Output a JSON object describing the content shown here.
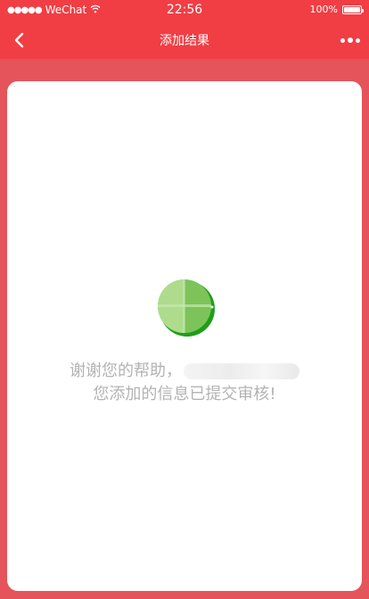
{
  "status_bar": {
    "signal_dots": "●●●●●",
    "carrier": "WeChat",
    "wifi_icon": "wifi-icon",
    "time": "22:56",
    "battery": "100%"
  },
  "nav": {
    "back_icon": "chevron-left-icon",
    "title": "添加结果",
    "more_icon": "more-dots-icon"
  },
  "result": {
    "icon": "success-check-icon",
    "line1": "谢谢您的帮助，",
    "line2": "您添加的信息已提交审核!"
  },
  "colors": {
    "header": "#f03e44",
    "background": "#e4545a",
    "success_green": "#1f9e1a",
    "text": "#b3b3b3"
  }
}
